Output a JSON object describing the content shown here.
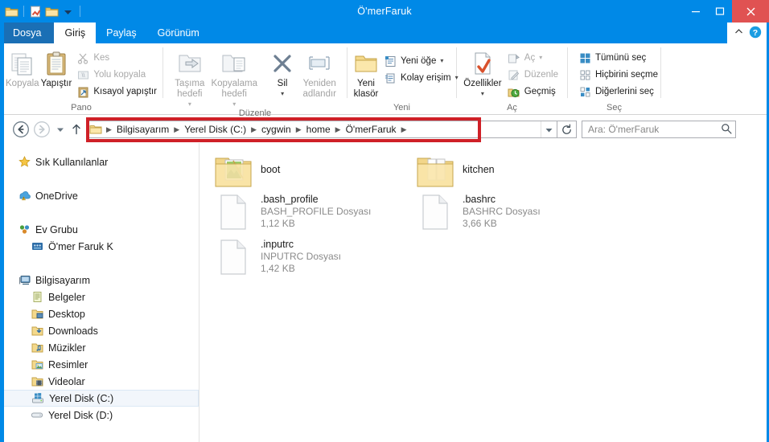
{
  "window": {
    "title": "Ö'merFaruk",
    "minimize_label": "Simge Durumuna Küçült",
    "maximize_label": "Ekranı Kapla",
    "close_label": "Kapat",
    "accent_color": "#0089e7",
    "close_color": "#e05252",
    "annotation_color": "#cf2027"
  },
  "quick_access": {
    "items": [
      {
        "name": "folder-icon",
        "label": "Klasör"
      },
      {
        "name": "properties-icon",
        "label": "Özellikler"
      },
      {
        "name": "new-folder-icon",
        "label": "Yeni klasör"
      },
      {
        "name": "chevron-down-icon",
        "label": "Hızlı Erişim Araç Çubuğunu Özelleştir"
      }
    ]
  },
  "tabs": [
    {
      "id": "file",
      "label": "Dosya",
      "active": false,
      "kind": "file"
    },
    {
      "id": "home",
      "label": "Giriş",
      "active": true,
      "kind": "normal"
    },
    {
      "id": "share",
      "label": "Paylaş",
      "active": false,
      "kind": "normal"
    },
    {
      "id": "view",
      "label": "Görünüm",
      "active": false,
      "kind": "normal"
    }
  ],
  "tab_right": {
    "collapse_icon": "chevron-up-icon",
    "help_icon": "help-icon"
  },
  "ribbon": {
    "groups": [
      {
        "id": "pano",
        "title": "Pano",
        "big_buttons": [
          {
            "id": "kopyala",
            "label": "Kopyala",
            "icon": "copy-icon",
            "disabled": true
          },
          {
            "id": "yapistir",
            "label": "Yapıştır",
            "icon": "paste-icon",
            "disabled": false
          }
        ],
        "small_buttons": [
          {
            "id": "kes",
            "label": "Kes",
            "icon": "scissors-icon",
            "disabled": true,
            "caret": false
          },
          {
            "id": "yolu-kopyala",
            "label": "Yolu kopyala",
            "icon": "copy-path-icon",
            "disabled": true,
            "caret": false
          },
          {
            "id": "kisayol-yapistir",
            "label": "Kısayol yapıştır",
            "icon": "paste-shortcut-icon",
            "disabled": false,
            "caret": false
          }
        ]
      },
      {
        "id": "duzenle",
        "title": "Düzenle",
        "big_buttons": [
          {
            "id": "tasima-hedefi",
            "label": "Taşıma\nhedefi",
            "icon": "move-to-icon",
            "disabled": true,
            "caret": true
          },
          {
            "id": "kopyalama-hedefi",
            "label": "Kopyalama\nhedefi",
            "icon": "copy-to-icon",
            "disabled": true,
            "caret": true
          },
          {
            "id": "sil",
            "label": "Sil",
            "icon": "delete-x-icon",
            "disabled": false,
            "caret": true
          },
          {
            "id": "yeniden-adlandir",
            "label": "Yeniden\nadlandır",
            "icon": "rename-icon",
            "disabled": true,
            "caret": false
          }
        ],
        "small_buttons": []
      },
      {
        "id": "yeni",
        "title": "Yeni",
        "big_buttons": [
          {
            "id": "yeni-klasor",
            "label": "Yeni\nklasör",
            "icon": "new-folder-icon",
            "disabled": false,
            "caret": false
          }
        ],
        "small_buttons": [
          {
            "id": "yeni-oge",
            "label": "Yeni öğe",
            "icon": "new-item-icon",
            "disabled": false,
            "caret": true
          },
          {
            "id": "kolay-erisim",
            "label": "Kolay erişim",
            "icon": "easy-access-icon",
            "disabled": false,
            "caret": true
          }
        ]
      },
      {
        "id": "ac",
        "title": "Aç",
        "big_buttons": [
          {
            "id": "ozellikler",
            "label": "Özellikler",
            "icon": "properties-icon",
            "disabled": false,
            "caret": true
          }
        ],
        "small_buttons": [
          {
            "id": "ac-btn",
            "label": "Aç",
            "icon": "open-icon",
            "disabled": true,
            "caret": true
          },
          {
            "id": "duzenle-btn",
            "label": "Düzenle",
            "icon": "edit-icon",
            "disabled": true,
            "caret": false
          },
          {
            "id": "gecmis",
            "label": "Geçmiş",
            "icon": "history-icon",
            "disabled": false,
            "caret": false
          }
        ]
      },
      {
        "id": "sec",
        "title": "Seç",
        "big_buttons": [],
        "small_buttons": [
          {
            "id": "tumunu-sec",
            "label": "Tümünü seç",
            "icon": "select-all-icon",
            "disabled": false,
            "caret": false
          },
          {
            "id": "hicbirini-secme",
            "label": "Hiçbirini seçme",
            "icon": "select-none-icon",
            "disabled": false,
            "caret": false
          },
          {
            "id": "digerlerini-sec",
            "label": "Diğerlerini seç",
            "icon": "invert-selection-icon",
            "disabled": false,
            "caret": false
          }
        ]
      }
    ]
  },
  "addressbar": {
    "back_label": "Geri",
    "forward_label": "İleri",
    "recent_label": "Son konumlar",
    "up_label": "Yukarı",
    "breadcrumbs": [
      {
        "label": "Bilgisayarım"
      },
      {
        "label": "Yerel Disk (C:)"
      },
      {
        "label": "cygwin"
      },
      {
        "label": "home"
      },
      {
        "label": "Ö'merFaruk"
      }
    ],
    "dropdown_label": "Önceki konumlar",
    "refresh_label": "Yenile",
    "search_placeholder": "Ara: Ö'merFaruk",
    "search_value": ""
  },
  "navpane": {
    "sections": [
      {
        "id": "favorites",
        "items": [
          {
            "id": "sik-kullanilanlar",
            "label": "Sık Kullanılanlar",
            "icon": "star-icon",
            "indent": 0,
            "selected": false
          }
        ]
      },
      {
        "id": "onedrive",
        "items": [
          {
            "id": "onedrive",
            "label": "OneDrive",
            "icon": "onedrive-icon",
            "indent": 0,
            "selected": false
          }
        ]
      },
      {
        "id": "homegroup",
        "items": [
          {
            "id": "ev-grubu",
            "label": "Ev Grubu",
            "icon": "homegroup-icon",
            "indent": 0,
            "selected": false
          },
          {
            "id": "omer-faruk-k",
            "label": "Ö'mer Faruk K",
            "icon": "user-icon",
            "indent": 1,
            "selected": false
          }
        ]
      },
      {
        "id": "computer",
        "items": [
          {
            "id": "bilgisayarim",
            "label": "Bilgisayarım",
            "icon": "computer-icon",
            "indent": 0,
            "selected": false
          },
          {
            "id": "belgeler",
            "label": "Belgeler",
            "icon": "documents-icon",
            "indent": 1,
            "selected": false
          },
          {
            "id": "desktop",
            "label": "Desktop",
            "icon": "desktop-icon",
            "indent": 1,
            "selected": false
          },
          {
            "id": "downloads",
            "label": "Downloads",
            "icon": "downloads-icon",
            "indent": 1,
            "selected": false
          },
          {
            "id": "muzikler",
            "label": "Müzikler",
            "icon": "music-icon",
            "indent": 1,
            "selected": false
          },
          {
            "id": "resimler",
            "label": "Resimler",
            "icon": "pictures-icon",
            "indent": 1,
            "selected": false
          },
          {
            "id": "videolar",
            "label": "Videolar",
            "icon": "videos-icon",
            "indent": 1,
            "selected": false
          },
          {
            "id": "yerel-disk-c",
            "label": "Yerel Disk (C:)",
            "icon": "windows-drive-icon",
            "indent": 1,
            "selected": true
          },
          {
            "id": "yerel-disk-d",
            "label": "Yerel Disk (D:)",
            "icon": "drive-icon",
            "indent": 1,
            "selected": false
          }
        ]
      }
    ]
  },
  "files": [
    {
      "id": "boot",
      "name": "boot",
      "type": "folder-picture",
      "subtype": "",
      "size": "",
      "col": 0,
      "row": 0
    },
    {
      "id": "kitchen",
      "name": "kitchen",
      "type": "folder",
      "subtype": "",
      "size": "",
      "col": 1,
      "row": 0
    },
    {
      "id": "bash_profile",
      "name": ".bash_profile",
      "type": "file",
      "subtype": "BASH_PROFILE Dosyası",
      "size": "1,12 KB",
      "col": 0,
      "row": 1
    },
    {
      "id": "bashrc",
      "name": ".bashrc",
      "type": "file",
      "subtype": "BASHRC Dosyası",
      "size": "3,66 KB",
      "col": 1,
      "row": 1
    },
    {
      "id": "inputrc",
      "name": ".inputrc",
      "type": "file",
      "subtype": "INPUTRC Dosyası",
      "size": "1,42 KB",
      "col": 0,
      "row": 2
    }
  ]
}
